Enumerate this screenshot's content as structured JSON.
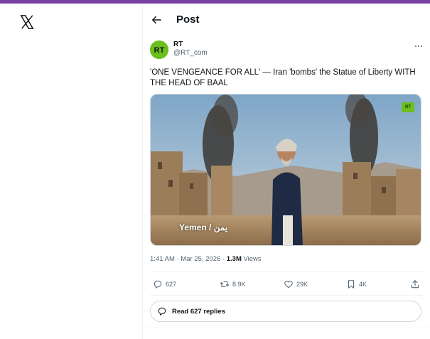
{
  "header": {
    "title": "Post",
    "back_icon": "arrow-left-icon"
  },
  "nav": {
    "logo_icon": "x-logo-icon"
  },
  "tweet": {
    "author_name": "RT",
    "author_handle": "@RT_com",
    "avatar_text": "RT",
    "text": "'ONE VENGEANCE FOR ALL' — Iran 'bombs' the Statue of Liberty WITH THE HEAD OF BAAL",
    "media": {
      "watermark": "Yemen / يمن",
      "badge": "RT"
    },
    "time": "1:41 AM · Mar 25, 2026 · ",
    "views_count": "1.3M",
    "views_label": " Views",
    "actions": {
      "replies": "627",
      "reposts": "8.9K",
      "likes": "29K",
      "bookmarks": "4K"
    },
    "read_replies": "Read 627 replies"
  },
  "colors": {
    "accent_bar": "#7a3fa3",
    "rt_green": "#6bbf1d",
    "secondary_text": "#536471"
  }
}
